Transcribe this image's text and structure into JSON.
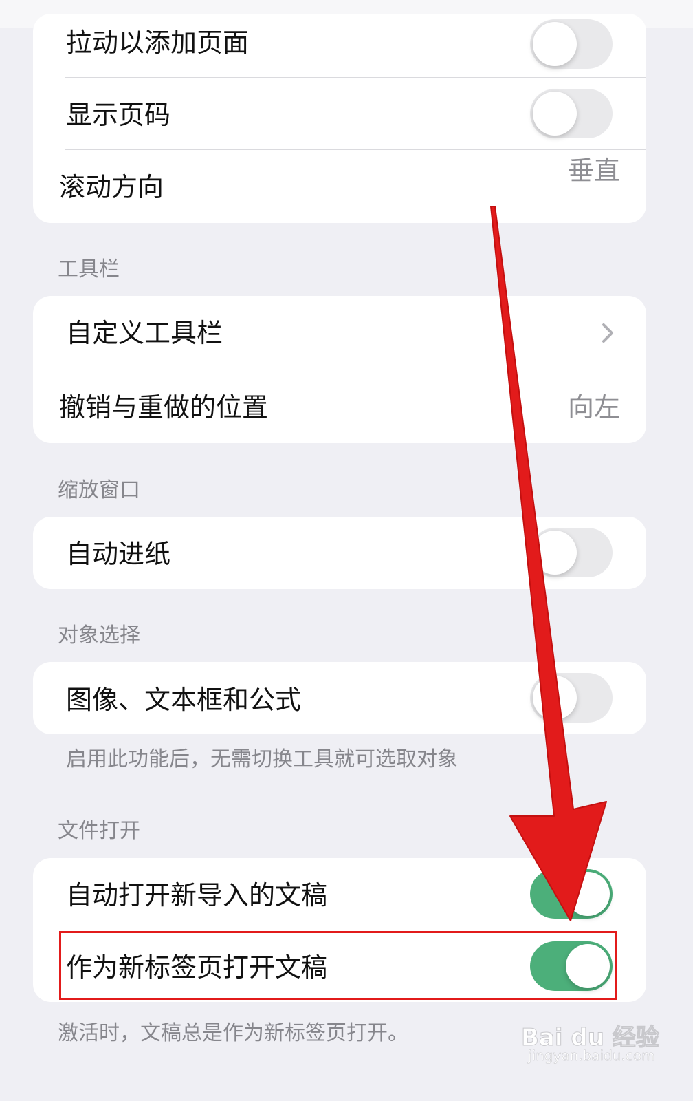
{
  "card1": {
    "rows": [
      {
        "label": "拉动以添加页面",
        "toggle": "off"
      },
      {
        "label": "显示页码",
        "toggle": "off"
      },
      {
        "label": "滚动方向",
        "value": "垂直"
      }
    ]
  },
  "toolbar_section": {
    "header": "工具栏",
    "rows": [
      {
        "label": "自定义工具栏"
      },
      {
        "label": "撤销与重做的位置",
        "value": "向左"
      }
    ]
  },
  "zoom_section": {
    "header": "缩放窗口",
    "rows": [
      {
        "label": "自动进纸",
        "toggle": "off"
      }
    ]
  },
  "object_section": {
    "header": "对象选择",
    "rows": [
      {
        "label": "图像、文本框和公式",
        "toggle": "off"
      }
    ],
    "footer": "启用此功能后，无需切换工具就可选取对象"
  },
  "file_section": {
    "header": "文件打开",
    "rows": [
      {
        "label": "自动打开新导入的文稿",
        "toggle": "on"
      },
      {
        "label": "作为新标签页打开文稿",
        "toggle": "on"
      }
    ],
    "footer": "激活时，文稿总是作为新标签页打开。"
  },
  "watermark": {
    "logo": "Bai du 经验",
    "url": "jingyan.baidu.com"
  },
  "colors": {
    "toggle_on": "#4caf7a",
    "annotation": "#e21b1b",
    "background": "#efeff4"
  }
}
